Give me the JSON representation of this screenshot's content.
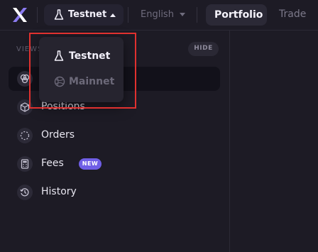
{
  "topbar": {
    "logo_icon": "x-logo-icon",
    "network_button": {
      "label": "Testnet",
      "icon": "flask-icon",
      "caret": "caret-up-icon"
    },
    "language": {
      "label": "English",
      "caret": "caret-down-icon"
    },
    "tabs": [
      {
        "label": "Portfolio",
        "active": true
      },
      {
        "label": "Trade",
        "active": false
      }
    ]
  },
  "sidebar": {
    "section_label": "VIEWS",
    "hide_label": "HIDE",
    "items": [
      {
        "label": "",
        "icon": "overview-icon",
        "active": true
      },
      {
        "label": "Positions",
        "icon": "cube-icon"
      },
      {
        "label": "Orders",
        "icon": "dashed-circle-icon"
      },
      {
        "label": "Fees",
        "icon": "calculator-icon",
        "badge": "NEW"
      },
      {
        "label": "History",
        "icon": "history-icon"
      }
    ]
  },
  "network_dropdown": {
    "options": [
      {
        "label": "Testnet",
        "icon": "flask-icon",
        "selected": true
      },
      {
        "label": "Mainnet",
        "icon": "globe-icon",
        "selected": false
      }
    ]
  },
  "colors": {
    "background": "#1d1b25",
    "accent": "#6f5ee6",
    "highlight_box": "#e0312f"
  }
}
